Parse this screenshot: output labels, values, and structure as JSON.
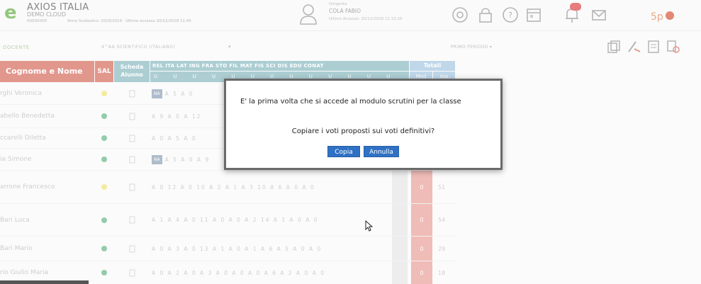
{
  "app": {
    "school_name": "AXIOS ITALIA",
    "school_sub": "DEMO CLOUD",
    "school_code": "00000000",
    "year_info": "Anno Scolastico: 2018/2019 · Ultimo accesso 20/12/2018 11:45",
    "user_role": "Dirigente",
    "user_name": "COLA FABIO",
    "user_login": "Ultimo Accesso: 20/12/2018 11:15:26"
  },
  "subheader": {
    "left_label": "DOCENTE",
    "class_label": "4^AA SCIENTIFICO (ITALIANO)",
    "dropdown_arrow": "▾",
    "period_label": "PRIMO PERIODO ▾"
  },
  "table": {
    "header_name": "Cognome e Nome",
    "header_sal": "SAL",
    "header_scheda": "Scheda Alunno",
    "header_subjects": "REL ITA LAT ING FRA STO FIL MAT FIS SCI DIS EDU CONAT",
    "header_uu": "U U U U U U U U U U U U U",
    "header_totali": "Totali",
    "header_med": "Med",
    "header_ass": "Ass",
    "rows": [
      {
        "name": "rghi Veronica",
        "sal_color": "#f3e27b",
        "votes": "A 5  A 0",
        "na": "NA",
        "med": "",
        "ass": ""
      },
      {
        "name": "abello Benedetta",
        "sal_color": "#6ab98a",
        "votes": "A 9  A 0  A 12",
        "na": "",
        "med": "",
        "ass": ""
      },
      {
        "name": "ccarelli Diletta",
        "sal_color": "#6ab98a",
        "votes": "A 0  A 5  A 0",
        "na": "",
        "med": "",
        "ass": ""
      },
      {
        "name": "ia Simone",
        "sal_color": "#6ab98a",
        "votes": "A 5  A 0  A 9",
        "na": "NA",
        "med": "",
        "ass": ""
      },
      {
        "name": "arrone Francesco",
        "sal_color": "#f3e27b",
        "votes": "A 0  12 A 0  10   A 2  A 1  A 3  10  A 6  A 0  A 0",
        "na": "",
        "med": "0",
        "ass": "51"
      },
      {
        "name": "Bari Luca",
        "sal_color": "#6ab98a",
        "votes": "A 1  A 4  A 0  11   A 0  A 0  A 2  14  A 1  A 0  A 0",
        "na": "",
        "med": "0",
        "ass": "54"
      },
      {
        "name": "Bari Mario",
        "sal_color": "#6ab98a",
        "votes": "A 0  A 3  A 0  13   A 1  A 0  A 1  A 6  A 5  A 0  A 0",
        "na": "",
        "med": "0",
        "ass": "29"
      },
      {
        "name": "rio Giulio Maria",
        "sal_color": "#6ab98a",
        "votes": "A 0  A 2  A 0  A 3   A 0  A 0  A 0  A 6  A 2  A 0  A 0",
        "na": "",
        "med": "0",
        "ass": "18"
      }
    ]
  },
  "modal": {
    "message_line1": "E' la prima volta che si accede al modulo scrutini per la classe",
    "message_line2": "Copiare i voti proposti sui voti definitivi?",
    "btn_copia": "Copia",
    "btn_annulla": "Annulla"
  },
  "colors": {
    "header_red": "#d76f62",
    "header_teal": "#8cbcc3",
    "header_blue": "#a8c8e2",
    "button_blue": "#2f71c4"
  },
  "icons": [
    "logo-mark",
    "user-avatar-icon",
    "help-circle-icon",
    "lock-icon",
    "question-icon",
    "calendar-icon",
    "notification-icon",
    "mail-icon",
    "copy-icon",
    "edit-icon",
    "document-icon",
    "settings-icon"
  ]
}
